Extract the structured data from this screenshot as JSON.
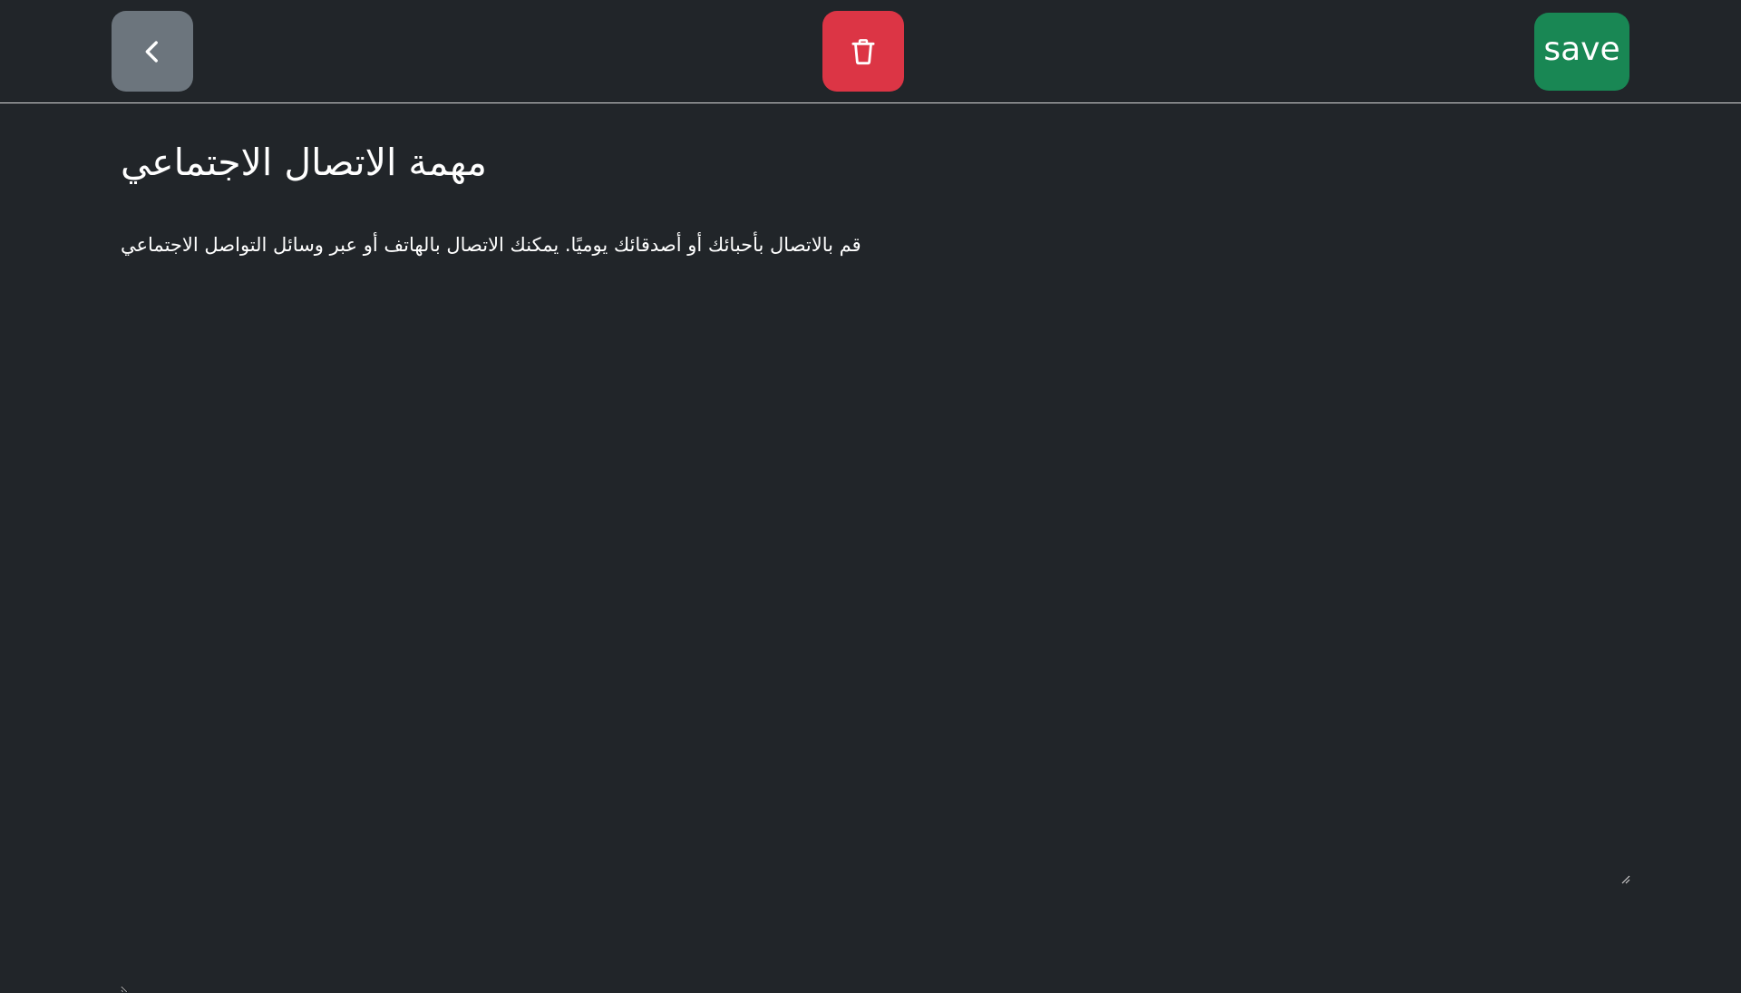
{
  "toolbar": {
    "back_icon": "chevron-left-icon",
    "delete_icon": "trash-icon",
    "save_label": "save",
    "colors": {
      "back": "#6c757d",
      "delete": "#dc3545",
      "save": "#198754"
    }
  },
  "task": {
    "title": "مهمة الاتصال الاجتماعي",
    "body": "قم بالاتصال بأحبائك أو أصدقائك يوميًا. يمكنك الاتصال بالهاتف أو عبر وسائل التواصل الاجتماعي"
  },
  "theme": {
    "background": "#212529",
    "text": "#ffffff"
  }
}
